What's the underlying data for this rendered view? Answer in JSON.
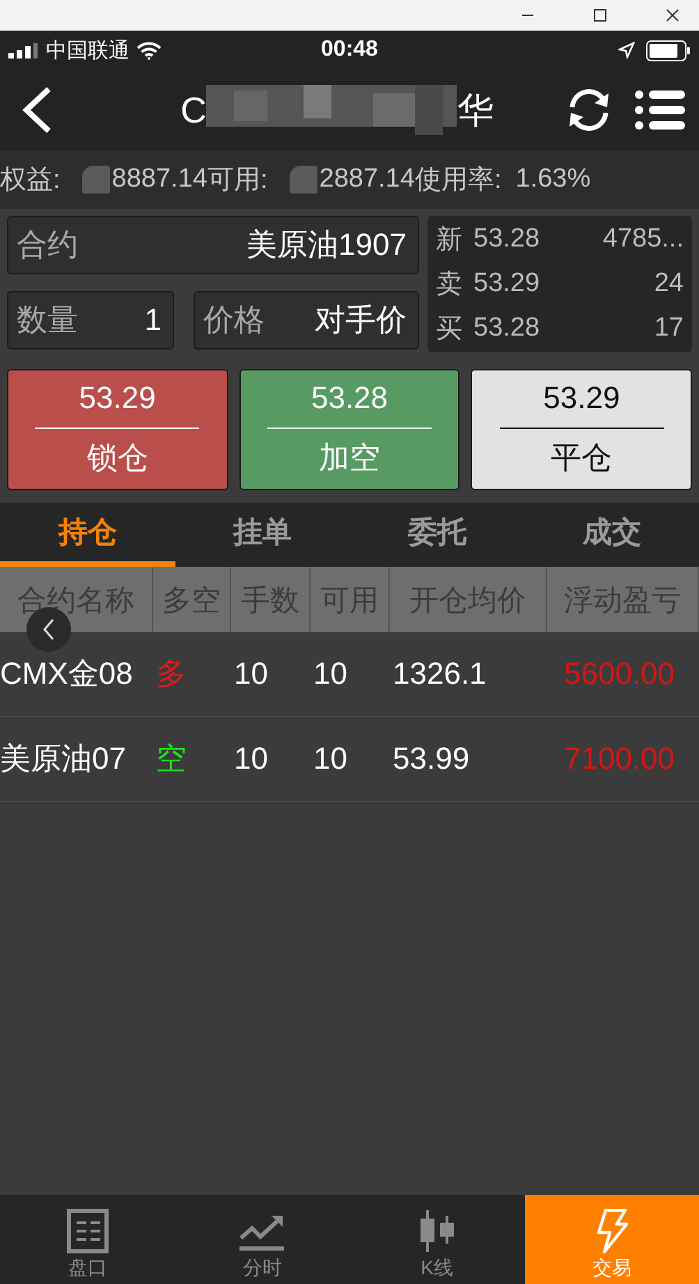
{
  "status_bar": {
    "carrier": "中国联通",
    "time": "00:48"
  },
  "nav": {
    "title_start": "C",
    "title_end": "华"
  },
  "account": [
    {
      "label": "权益:",
      "value": "8887.14"
    },
    {
      "label": "可用:",
      "value": "2887.14"
    },
    {
      "label": "使用率:",
      "value": "1.63%"
    }
  ],
  "order": {
    "contract": {
      "label": "合约",
      "value": "美原油1907"
    },
    "quantity": {
      "label": "数量",
      "value": "1"
    },
    "price": {
      "label": "价格",
      "value": "对手价"
    }
  },
  "quotes": [
    {
      "label": "新",
      "price": "53.28",
      "volume": "4785..."
    },
    {
      "label": "卖",
      "price": "53.29",
      "volume": "24"
    },
    {
      "label": "买",
      "price": "53.28",
      "volume": "17"
    }
  ],
  "actions": [
    {
      "kind": "lock",
      "price": "53.29",
      "label": "锁仓"
    },
    {
      "kind": "short",
      "price": "53.28",
      "label": "加空"
    },
    {
      "kind": "close",
      "price": "53.29",
      "label": "平仓"
    }
  ],
  "tabs": [
    {
      "label": "持仓",
      "selected": true
    },
    {
      "label": "挂单",
      "selected": false
    },
    {
      "label": "委托",
      "selected": false
    },
    {
      "label": "成交",
      "selected": false
    }
  ],
  "table": {
    "columns": [
      "合约名称",
      "多空",
      "手数",
      "可用",
      "开仓均价",
      "浮动盈亏"
    ],
    "rows": [
      {
        "color": "#e21a1a",
        "cells": [
          "CMX金08",
          "多",
          "10",
          "10",
          "1326.1",
          "5600.00"
        ]
      },
      {
        "color": "#1ee01e",
        "cells": [
          "美原油07",
          "空",
          "10",
          "10",
          "53.99",
          "7100.00"
        ]
      }
    ]
  },
  "bottom_nav": [
    {
      "label": "盘口",
      "selected": false
    },
    {
      "label": "分时",
      "selected": false
    },
    {
      "label": "K线",
      "selected": false
    },
    {
      "label": "交易",
      "selected": true
    }
  ]
}
